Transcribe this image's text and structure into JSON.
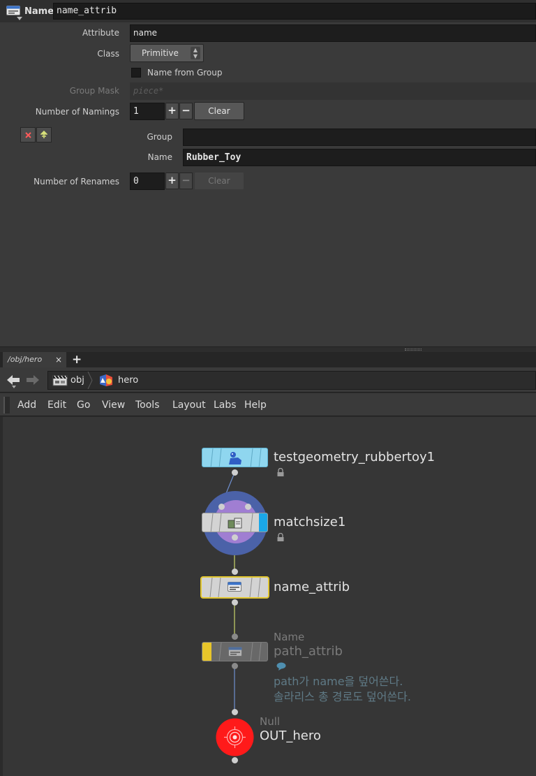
{
  "param_pane": {
    "node_type_label": "Name",
    "node_name": "name_attrib",
    "attribute": {
      "label": "Attribute",
      "value": "name"
    },
    "class": {
      "label": "Class",
      "value": "Primitive"
    },
    "name_from_group": {
      "label": "Name from Group",
      "checked": false
    },
    "group_mask": {
      "label": "Group Mask",
      "placeholder": "piece*"
    },
    "number_of_namings": {
      "label": "Number of Namings",
      "value": "1",
      "plus": "+",
      "minus": "−",
      "clear": "Clear"
    },
    "naming_1": {
      "remove_icon": "close-icon",
      "insert_icon": "insert-icon",
      "group": {
        "label": "Group",
        "value": ""
      },
      "name": {
        "label": "Name",
        "value": "Rubber_Toy"
      }
    },
    "number_of_renames": {
      "label": "Number of Renames",
      "value": "0",
      "plus": "+",
      "minus": "−",
      "clear": "Clear"
    }
  },
  "network_pane": {
    "tab": {
      "label": "/obj/hero",
      "close": "×",
      "add": "+"
    },
    "path": [
      {
        "label": "obj",
        "icon": "obj-context-icon"
      },
      {
        "label": "hero",
        "icon": "geometry-object-icon"
      }
    ],
    "menu": [
      "Add",
      "Edit",
      "Go",
      "View",
      "Tools",
      "Layout",
      "Labs",
      "Help"
    ],
    "nodes": {
      "testgeometry": {
        "name": "testgeometry_rubbertoy1",
        "icon": "rubber-toy-icon",
        "locked": true
      },
      "matchsize": {
        "name": "matchsize1",
        "icon": "matchsize-icon",
        "locked": true,
        "display_flag_color": "#1aa7e8"
      },
      "name_attrib": {
        "name": "name_attrib",
        "icon": "name-sop-icon",
        "selected": true,
        "highlight_color": "#e2c730"
      },
      "path_attrib": {
        "type": "Name",
        "name": "path_attrib",
        "bypass_color": "#e8c52a",
        "comment_icon": "comment-bubble-icon",
        "comment_line1": "path가 name을 덮어쓴다.",
        "comment_line2": "솔라리스 총 경로도 덮어쓴다."
      },
      "out_hero": {
        "type": "Null",
        "name": "OUT_hero",
        "color": "#ff1a1a"
      }
    }
  }
}
